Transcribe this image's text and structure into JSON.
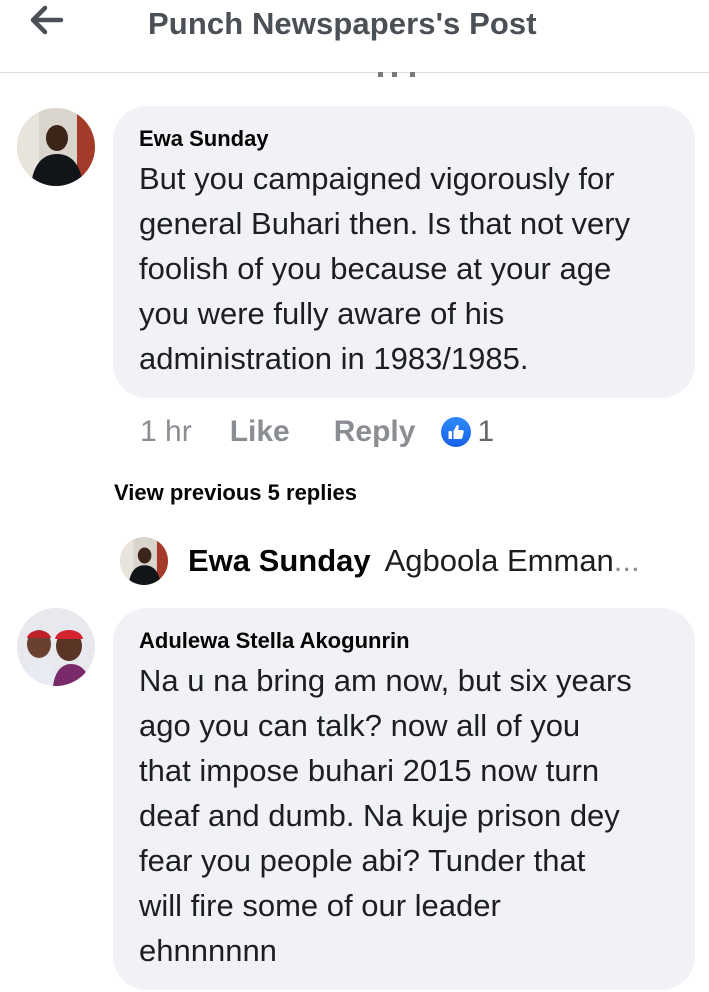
{
  "header": {
    "title": "Punch Newspapers's Post",
    "back_icon": "arrow-left-icon"
  },
  "comments": [
    {
      "author": "Ewa Sunday",
      "text": "But you campaigned vigorously for\ngeneral Buhari then. Is that not very\nfoolish of you because at your age\nyou were fully aware of his\nadministration in 1983/1985.",
      "time": "1 hr",
      "like_label": "Like",
      "reply_label": "Reply",
      "reaction_icon": "like-thumb-icon",
      "reaction_count": "1"
    },
    {
      "author": "Adulewa Stella Akogunrin",
      "text": "Na u na bring am now, but six years\nago you can talk? now all of you\nthat impose buhari 2015 now turn\ndeaf and dumb. Na kuje prison dey\nfear you people abi? Tunder that\nwill fire some of our leader\nehnnnnnn"
    }
  ],
  "replies": {
    "view_previous_label": "View previous 5 replies",
    "latest_author": "Ewa Sunday",
    "latest_preview": "Agboola Emman",
    "ellipsis": "..."
  },
  "colors": {
    "bubble": "#f0f2f5",
    "meta_gray": "#8a8d91",
    "like_blue": "#1877f2"
  }
}
